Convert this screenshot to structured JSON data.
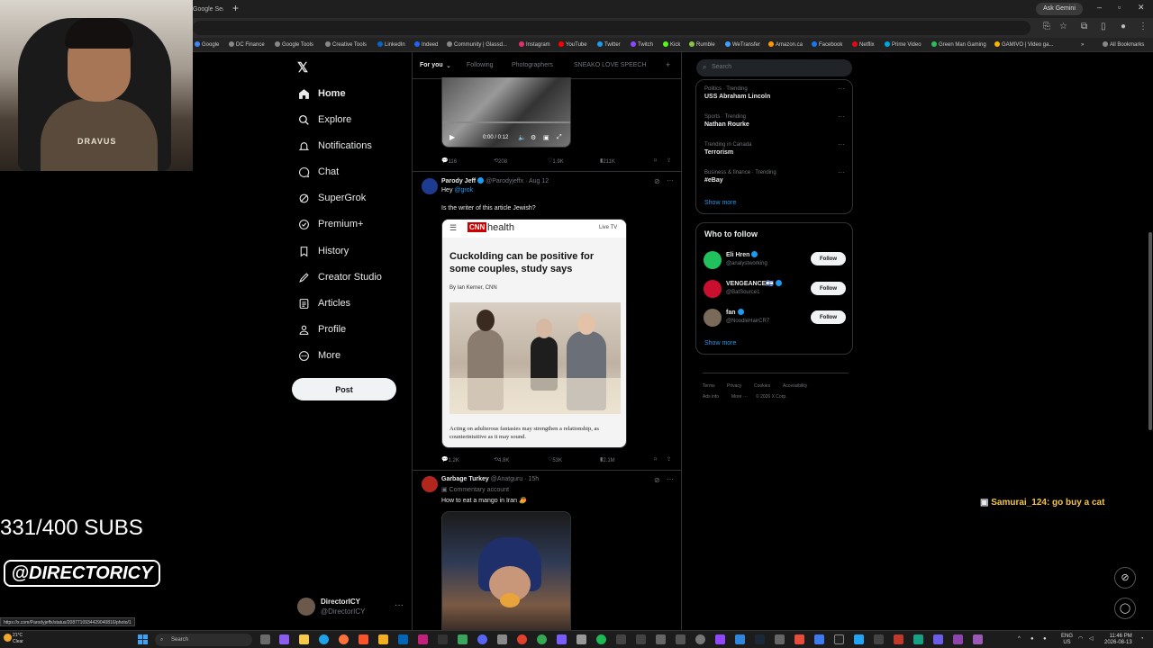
{
  "browser": {
    "tab_title": "Google Search",
    "ask_gemini": "Ask Gemini",
    "bookmarks": [
      {
        "label": "Google",
        "color": "#4285f4"
      },
      {
        "label": "DC Finance",
        "color": "#888888"
      },
      {
        "label": "Google Tools",
        "color": "#888888"
      },
      {
        "label": "Creative Tools",
        "color": "#888888"
      },
      {
        "label": "LinkedIn",
        "color": "#0a66c2"
      },
      {
        "label": "Indeed",
        "color": "#2164f3"
      },
      {
        "label": "Community | Glassd...",
        "color": "#888888"
      },
      {
        "label": "Instagram",
        "color": "#e1306c"
      },
      {
        "label": "YouTube",
        "color": "#ff0000"
      },
      {
        "label": "Twitter",
        "color": "#1d9bf0"
      },
      {
        "label": "Twitch",
        "color": "#9146ff"
      },
      {
        "label": "Kick",
        "color": "#53fc18"
      },
      {
        "label": "Rumble",
        "color": "#85c742"
      },
      {
        "label": "WeTransfer",
        "color": "#409fff"
      },
      {
        "label": "Amazon.ca",
        "color": "#ff9900"
      },
      {
        "label": "Facebook",
        "color": "#1877f2"
      },
      {
        "label": "Netflix",
        "color": "#e50914"
      },
      {
        "label": "Prime Video",
        "color": "#00a8e1"
      },
      {
        "label": "Green Man Gaming",
        "color": "#2bbf5a"
      },
      {
        "label": "GAMIVO | Video ga...",
        "color": "#f7b500"
      }
    ],
    "all_bookmarks": "All Bookmarks",
    "status_url": "https://x.com/Parodyjeffx/status/2087710934429040816/photo/1"
  },
  "webcam": {
    "shirt_text": "DRAVUS"
  },
  "nav": {
    "items": [
      {
        "label": "Home",
        "icon": "home-icon"
      },
      {
        "label": "Explore",
        "icon": "search-icon"
      },
      {
        "label": "Notifications",
        "icon": "bell-icon"
      },
      {
        "label": "Chat",
        "icon": "chat-icon"
      },
      {
        "label": "SuperGrok",
        "icon": "grok-icon"
      },
      {
        "label": "Premium+",
        "icon": "premium-icon"
      },
      {
        "label": "History",
        "icon": "history-icon"
      },
      {
        "label": "Creator Studio",
        "icon": "rocket-icon"
      },
      {
        "label": "Articles",
        "icon": "articles-icon"
      },
      {
        "label": "Profile",
        "icon": "profile-icon"
      },
      {
        "label": "More",
        "icon": "more-icon"
      }
    ],
    "post_label": "Post",
    "account": {
      "name": "DirectorICY",
      "handle": "@DirectorICY"
    }
  },
  "feed": {
    "tabs": [
      "For you",
      "Following",
      "Photographers",
      "SNEAKO LOVE SPEECH"
    ],
    "top_video": {
      "time": "0:00 / 0:12",
      "stats": {
        "replies": "116",
        "reposts": "208",
        "likes": "1.9K",
        "views": "211K"
      }
    },
    "tweet1": {
      "name": "Parody Jeff",
      "handle": "@Parodyjeffx",
      "date": "Aug 12",
      "reply_prefix": "Hey",
      "reply_mention": "@grok",
      "text": "Is the writer of this article Jewish?",
      "article": {
        "brand": "CNN",
        "section": "health",
        "live": "Live TV",
        "headline": "Cuckolding can be positive for some couples, study says",
        "byline": "By Ian Kerner, CNN",
        "caption": "Acting on adulterous fantasies may strengthen a relationship, as counterintuitive as it may sound."
      },
      "stats": {
        "replies": "1.2K",
        "reposts": "4.8K",
        "likes": "53K",
        "views": "2.1M"
      }
    },
    "tweet2": {
      "name": "Garbage Turkey",
      "handle": "@Anatguru",
      "date": "15h",
      "tag": "Commentary account",
      "text": "How to eat a mango in Iran 🥭"
    }
  },
  "right": {
    "search_placeholder": "Search",
    "trends": [
      {
        "category": "Politics · Trending",
        "name": "USS Abraham Lincoln"
      },
      {
        "category": "Sports · Trending",
        "name": "Nathan Rourke"
      },
      {
        "category": "Trending in Canada",
        "name": "Terrorism"
      },
      {
        "category": "Business & finance · Trending",
        "name": "#eBay"
      }
    ],
    "trends_show_more": "Show more",
    "who_to_follow_title": "Who to follow",
    "who_to_follow": [
      {
        "name": "Eli Hren",
        "handle": "@analystworking",
        "color": "#21c25e"
      },
      {
        "name": "VENGEANCE🇮🇱",
        "handle": "@BatSource1",
        "color": "#c8102e"
      },
      {
        "name": "fan",
        "handle": "@NoodleHairCR7",
        "color": "#7a6a5a"
      }
    ],
    "follow_label": "Follow",
    "wtf_show_more": "Show more",
    "footer_row1": [
      "Terms",
      "Privacy",
      "Cookies",
      "Accessibility"
    ],
    "footer_row2": [
      "Ads info",
      "More ···",
      "© 2026 X Corp."
    ]
  },
  "overlay": {
    "subs": "331/400 SUBS",
    "handle": "@DIRECTORICY",
    "chat_user": "Samurai_124",
    "chat_msg": ": go buy a cat"
  },
  "taskbar": {
    "weather_temp": "21°C",
    "weather_text": "Clear",
    "search": "Search",
    "lang": "ENG",
    "region": "US",
    "time": "11:46 PM",
    "date": "2026-08-13"
  }
}
